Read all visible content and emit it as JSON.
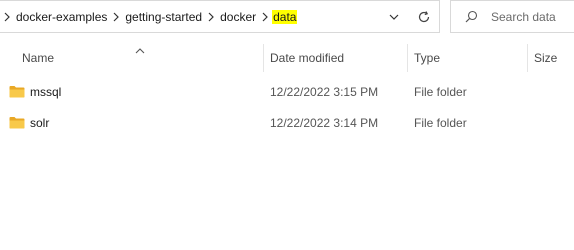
{
  "breadcrumb": {
    "items": [
      "docker-examples",
      "getting-started",
      "docker",
      "data"
    ]
  },
  "search": {
    "placeholder": "Search data"
  },
  "columns": {
    "name": "Name",
    "date": "Date modified",
    "type": "Type",
    "size": "Size"
  },
  "rows": [
    {
      "name": "mssql",
      "date": "12/22/2022 3:15 PM",
      "type": "File folder",
      "size": ""
    },
    {
      "name": "solr",
      "date": "12/22/2022 3:14 PM",
      "type": "File folder",
      "size": ""
    }
  ],
  "icons": {
    "folder_color": "#f6c244",
    "highlight_color": "#ffff00"
  }
}
